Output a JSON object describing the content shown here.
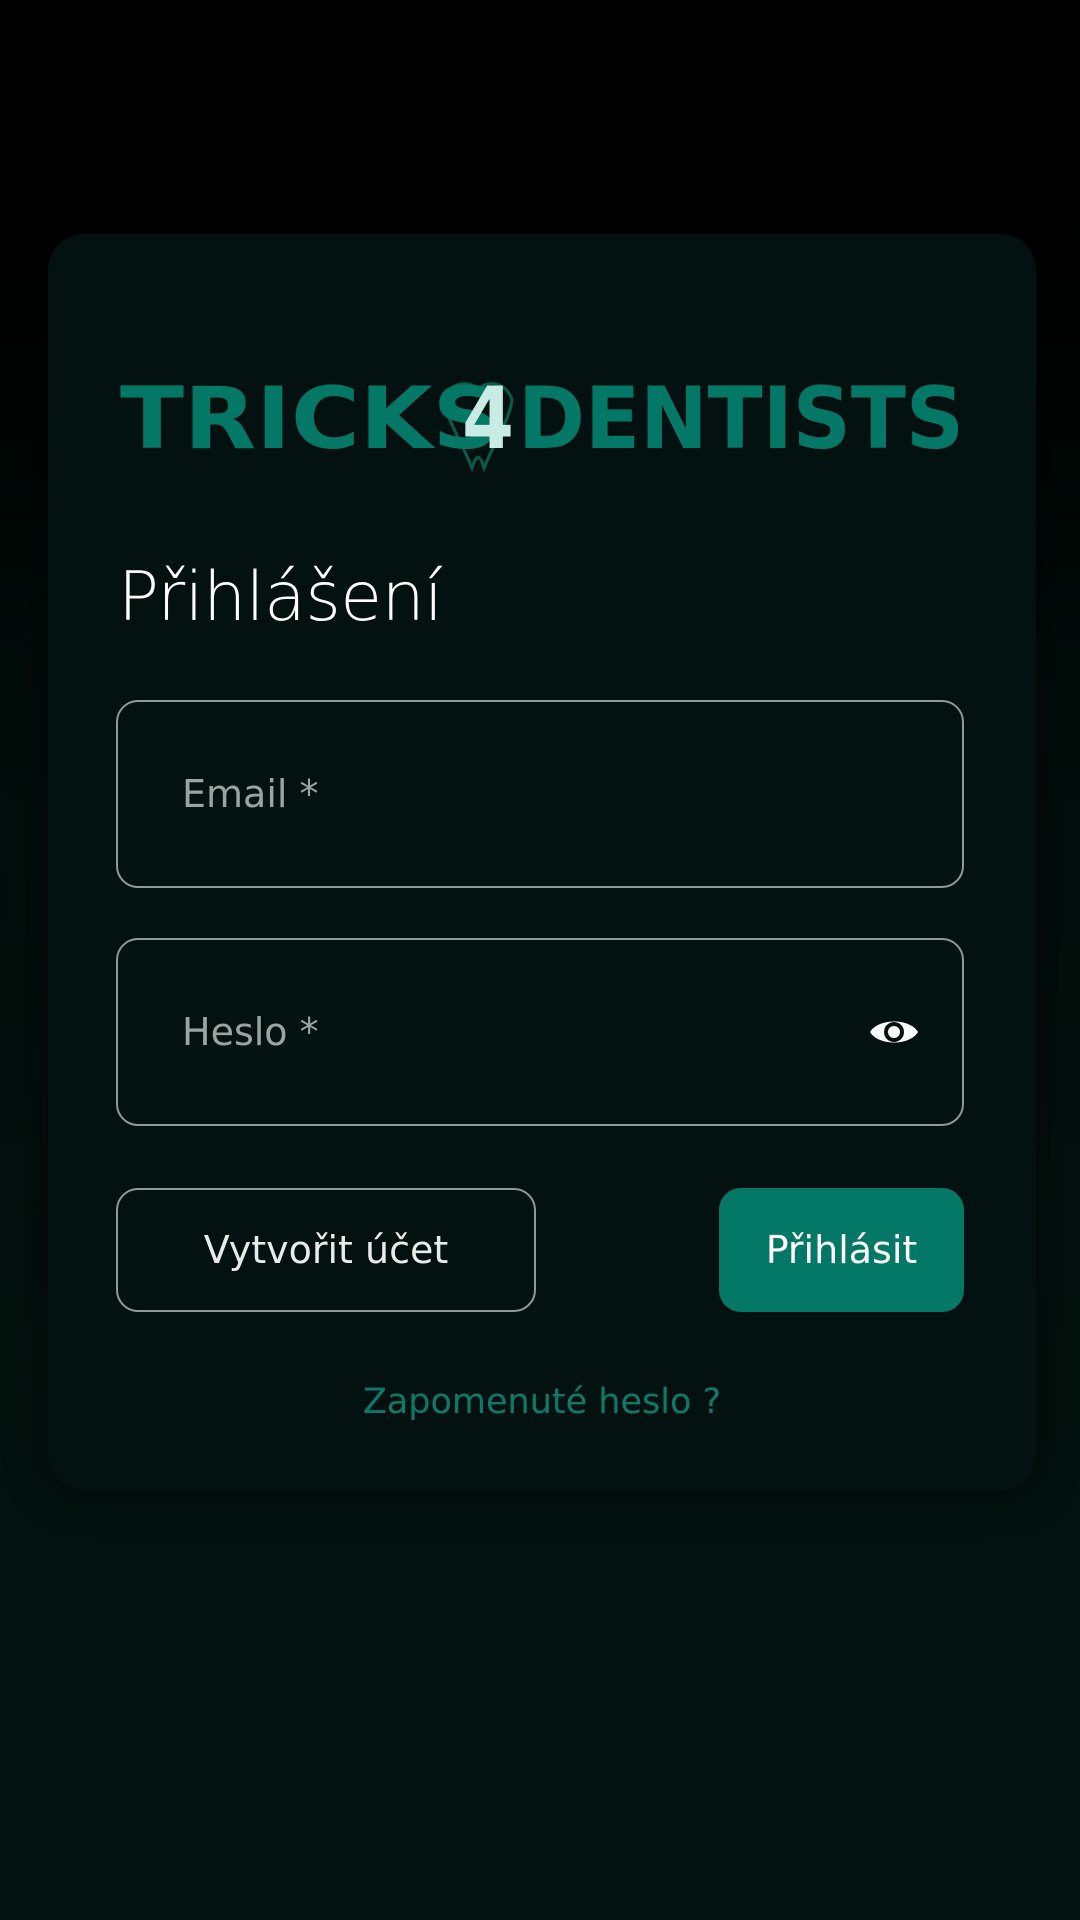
{
  "brand": {
    "logo_text": "TRICKS4DENTISTS",
    "logo_part1": "TRICKS",
    "logo_digit": "4",
    "logo_part2": "DENTISTS",
    "accent_color": "#047867",
    "digit_color": "#c8ece3"
  },
  "login": {
    "title": "Přihlášení",
    "email_placeholder": "Email *",
    "password_placeholder": "Heslo *",
    "create_account_label": "Vytvořit účet",
    "login_label": "Přihlásit",
    "forgot_password_label": "Zapomenuté heslo ?"
  },
  "icons": {
    "password_toggle": "eye-icon"
  }
}
